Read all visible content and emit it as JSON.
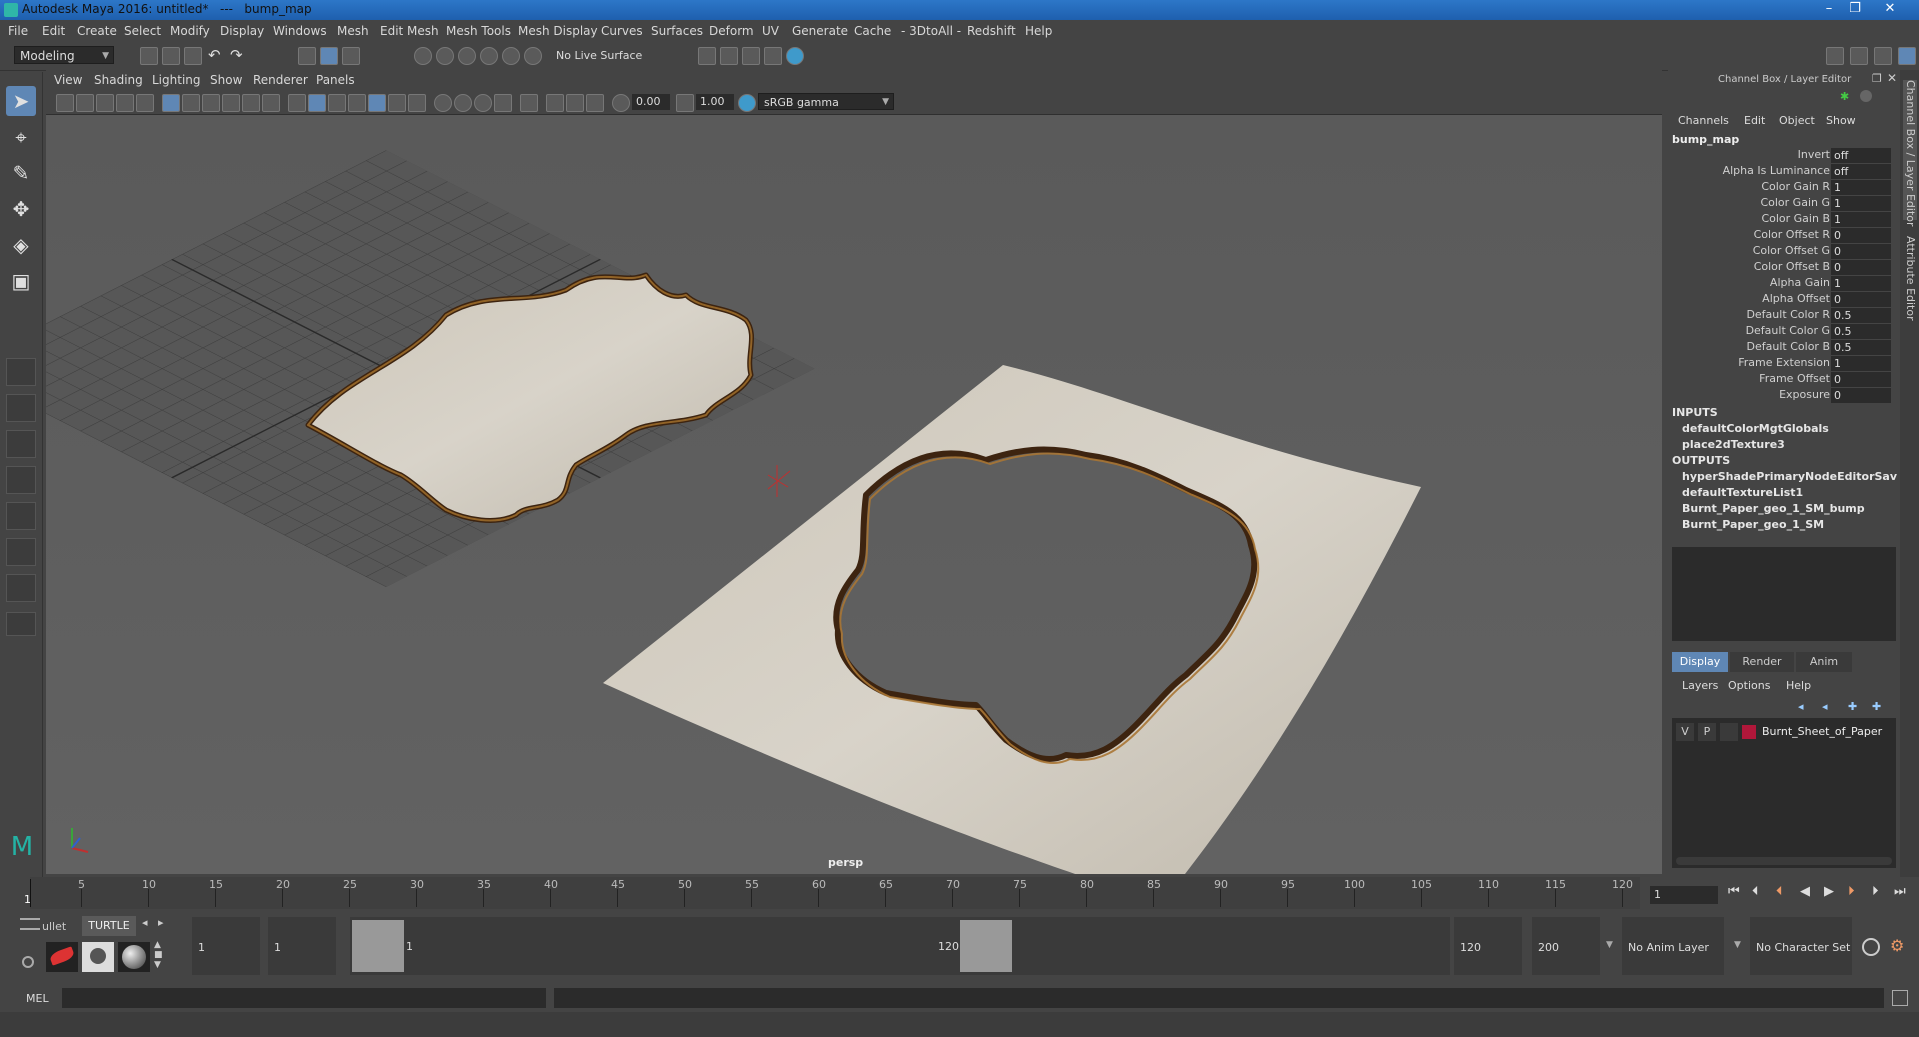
{
  "app": {
    "title": "Autodesk Maya 2016: untitled*   ---   bump_map"
  },
  "menu": [
    "File",
    "Edit",
    "Create",
    "Select",
    "Modify",
    "Display",
    "Windows",
    "Mesh",
    "Edit Mesh",
    "Mesh Tools",
    "Mesh Display",
    "Curves",
    "Surfaces",
    "Deform",
    "UV",
    "Generate",
    "Cache",
    "- 3DtoAll -",
    "Redshift",
    "Help"
  ],
  "statusline": {
    "mode": "Modeling",
    "live_surface": "No Live Surface"
  },
  "viewport_menu": [
    "View",
    "Shading",
    "Lighting",
    "Show",
    "Renderer",
    "Panels"
  ],
  "viewport_bar": {
    "exposure": "0.00",
    "gamma": "1.00",
    "color_space": "sRGB gamma"
  },
  "viewport": {
    "camera": "persp"
  },
  "channel_box": {
    "title": "Channel Box / Layer Editor",
    "menus": [
      "Channels",
      "Edit",
      "Object",
      "Show"
    ],
    "node": "bump_map",
    "attributes": [
      {
        "label": "Invert",
        "value": "off"
      },
      {
        "label": "Alpha Is Luminance",
        "value": "off"
      },
      {
        "label": "Color Gain R",
        "value": "1"
      },
      {
        "label": "Color Gain G",
        "value": "1"
      },
      {
        "label": "Color Gain B",
        "value": "1"
      },
      {
        "label": "Color Offset R",
        "value": "0"
      },
      {
        "label": "Color Offset G",
        "value": "0"
      },
      {
        "label": "Color Offset B",
        "value": "0"
      },
      {
        "label": "Alpha Gain",
        "value": "1"
      },
      {
        "label": "Alpha Offset",
        "value": "0"
      },
      {
        "label": "Default Color R",
        "value": "0.5"
      },
      {
        "label": "Default Color G",
        "value": "0.5"
      },
      {
        "label": "Default Color B",
        "value": "0.5"
      },
      {
        "label": "Frame Extension",
        "value": "1"
      },
      {
        "label": "Frame Offset",
        "value": "0"
      },
      {
        "label": "Exposure",
        "value": "0"
      }
    ],
    "inputs_label": "INPUTS",
    "inputs": [
      "defaultColorMgtGlobals",
      "place2dTexture3"
    ],
    "outputs_label": "OUTPUTS",
    "outputs": [
      "hyperShadePrimaryNodeEditorSavedT...",
      "defaultTextureList1",
      "Burnt_Paper_geo_1_SM_bump",
      "Burnt_Paper_geo_1_SM"
    ]
  },
  "side_tabs": [
    "Channel Box / Layer Editor",
    "Attribute Editor"
  ],
  "layer_editor": {
    "tabs": [
      "Display",
      "Render",
      "Anim"
    ],
    "menus": [
      "Layers",
      "Options",
      "Help"
    ],
    "layers": [
      {
        "v": "V",
        "p": "P",
        "name": "Burnt_Sheet_of_Paper",
        "color": "#b0173a"
      }
    ]
  },
  "timeline": {
    "ticks": [
      "5",
      "10",
      "15",
      "20",
      "25",
      "30",
      "35",
      "40",
      "45",
      "50",
      "55",
      "60",
      "65",
      "70",
      "75",
      "80",
      "85",
      "90",
      "95",
      "100",
      "105",
      "110",
      "115",
      "120"
    ],
    "start_label": "1",
    "current_frame": "1"
  },
  "range": {
    "shelf_tabs": [
      "ullet",
      "TURTLE"
    ],
    "start": "1",
    "playback_start": "1",
    "slider_start": "1",
    "slider_end": "120",
    "playback_end": "120",
    "end": "200",
    "anim_layer": "No Anim Layer",
    "char_set": "No Character Set"
  },
  "cmd": {
    "label": "MEL"
  },
  "colors": {
    "accent": "#5f87b5",
    "title_bar": "#2d77c8",
    "paper": "#d8d3c8",
    "burn": "#4a2c10"
  }
}
